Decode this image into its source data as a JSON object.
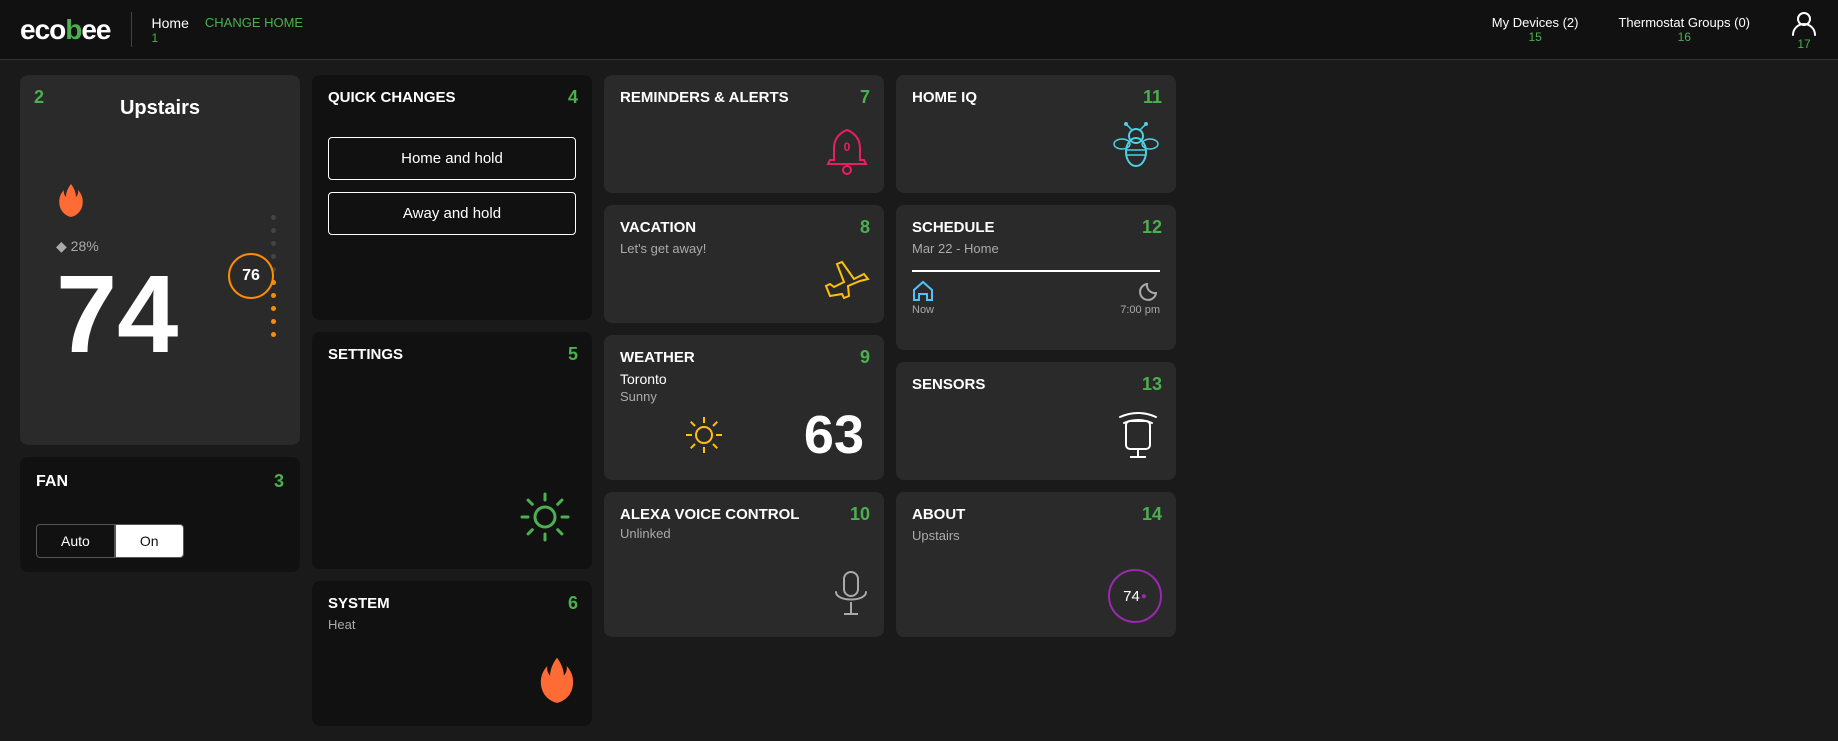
{
  "header": {
    "logo_text": "ecobee",
    "home_label": "Home",
    "home_num": "1",
    "change_home": "CHANGE HOME",
    "my_devices_label": "My Devices",
    "my_devices_count": "(2)",
    "my_devices_num": "15",
    "thermostat_groups_label": "Thermostat Groups",
    "thermostat_groups_count": "(0)",
    "thermostat_groups_num": "16",
    "user_num": "17"
  },
  "thermostat": {
    "card_num": "2",
    "name": "Upstairs",
    "humidity": "28%",
    "current_temp": "74",
    "setpoint": "76",
    "flame_icon": "🔥"
  },
  "fan": {
    "card_num": "3",
    "label": "FAN",
    "auto_label": "Auto",
    "on_label": "On"
  },
  "quick_changes": {
    "card_num": "4",
    "title": "QUICK CHANGES",
    "home_hold": "Home and hold",
    "away_hold": "Away and hold"
  },
  "settings": {
    "card_num": "5",
    "title": "SETTINGS"
  },
  "system": {
    "card_num": "6",
    "title": "SYSTEM",
    "subtitle": "Heat"
  },
  "reminders": {
    "card_num": "7",
    "title": "REMINDERS & ALERTS",
    "bell_count": "0"
  },
  "vacation": {
    "card_num": "8",
    "title": "VACATION",
    "subtitle": "Let's get away!"
  },
  "weather": {
    "card_num": "9",
    "title": "WEATHER",
    "city": "Toronto",
    "condition": "Sunny",
    "temp": "63"
  },
  "alexa": {
    "card_num": "10",
    "title": "ALEXA VOICE CONTROL",
    "status": "Unlinked"
  },
  "homeiq": {
    "card_num": "11",
    "title": "HOME IQ"
  },
  "schedule": {
    "card_num": "12",
    "title": "SCHEDULE",
    "date": "Mar 22 - Home",
    "now_label": "Now",
    "time_label": "7:00 pm"
  },
  "sensors": {
    "card_num": "13",
    "title": "SENSORS"
  },
  "about": {
    "card_num": "14",
    "title": "ABOUT",
    "subtitle": "Upstairs",
    "temp": "74"
  }
}
